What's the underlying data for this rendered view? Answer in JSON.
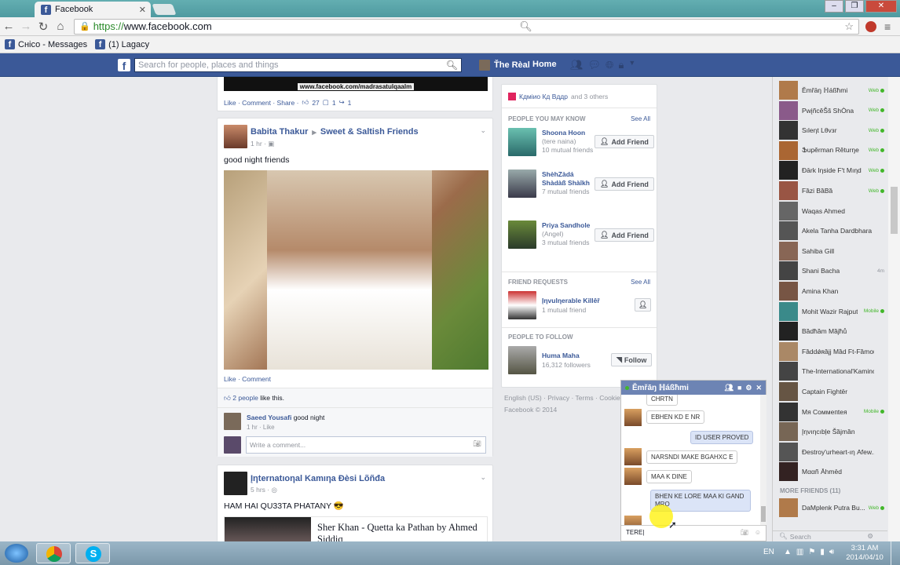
{
  "browser": {
    "tab_title": "Facebook",
    "url_prefix": "https://",
    "url_rest": "www.facebook.com",
    "bookmarks": [
      "Снісо - Messages",
      "(1) Lagacy"
    ]
  },
  "fbbar": {
    "logo": "f",
    "search_placeholder": "Search for people, places and things",
    "user": "Ťhe Rèal",
    "home": "Home"
  },
  "feed": {
    "top_post": {
      "banner_text": "www.facebook.com/madrasatulqaalm",
      "actions": "Like · Comment · Share ·",
      "likes": "27",
      "comments": "1",
      "shares": "1"
    },
    "post1": {
      "author": "Babita Thakur",
      "arrow": "▸",
      "group": "Sweet & Saltish Friends",
      "time": "1 hr ·",
      "text": "good night friends",
      "actions": "Like · Comment",
      "likes_count": "2 people",
      "likes_suffix": "like this.",
      "comment_author": "Saeed Yousafi",
      "comment_text": "good night",
      "comment_meta": "1 hr · Like",
      "comment_placeholder": "Write a comment..."
    },
    "post2": {
      "author": "Įηternatıoηal Kamıηa Ðèsi Lõñđa",
      "time": "5 hrs ·",
      "text": "HAM HAI QU33TA PHATANY 😎",
      "link_title": "Sher Khan - Quetta ka Pathan by Ahmed Siddiq"
    }
  },
  "rightcol": {
    "header_name": "Кдміио Кд Вддр",
    "header_suffix": "and 3 others",
    "pymk_title": "PEOPLE YOU MAY KNOW",
    "see_all": "See All",
    "add_friend": "Add Friend",
    "pymk": [
      {
        "name": "Shoona Hoon",
        "sub": "(tere naina)",
        "mutual": "10 mutual friends"
      },
      {
        "name": "ShèhZàdá Shàdàß Shàîkh",
        "sub": "",
        "mutual": "7 mutual friends"
      },
      {
        "name": "Priya Sandhole",
        "sub": "(Angel)",
        "mutual": "3 mutual friends"
      }
    ],
    "fr_title": "FRIEND REQUESTS",
    "fr": {
      "name": "Įηvulηerable Killêř",
      "mutual": "1 mutual friend"
    },
    "ptf_title": "PEOPLE TO FOLLOW",
    "ptf": {
      "name": "Huma Maha",
      "followers": "16,312 followers",
      "button": "Follow"
    },
    "footer1": "English (US) · Privacy · Terms · Cookie",
    "footer2": "Facebook © 2014"
  },
  "chat": {
    "title": "Ĕmřāŋ ℍáßħmi",
    "messages": [
      {
        "text": "CHRTN",
        "me": false
      },
      {
        "text": "EBHEN KD E NR",
        "me": false
      },
      {
        "text": "ID USER PROVED",
        "me": true
      },
      {
        "text": "NARSNDI MAKE BGAHXC E",
        "me": false
      },
      {
        "text": "MAA K DINE",
        "me": false
      },
      {
        "text": "BHEN KE LORE MAA KI GAND MRO",
        "me": true
      }
    ],
    "input_value": "TERE"
  },
  "sidebar": {
    "friends": [
      {
        "name": "Ĕmřāŋ ℍáßħmi",
        "status": "Web"
      },
      {
        "name": "PwįñcěŠš ShÒna",
        "status": "Web"
      },
      {
        "name": "Sıleηt Lθvзr",
        "status": "Web"
      },
      {
        "name": "Ֆupěrman Rěturŋe",
        "status": "Web"
      },
      {
        "name": "Ðārk Iηside F't Mıηd",
        "status": "Web"
      },
      {
        "name": "Fȁzi BȁBȁ",
        "status": "Web"
      },
      {
        "name": "Waqas Ahmed",
        "status": ""
      },
      {
        "name": "Akela Tanha Dardbhara ...",
        "status": ""
      },
      {
        "name": "Sahiba Gill",
        "status": ""
      },
      {
        "name": "Shani Bacha",
        "status": "4m"
      },
      {
        "name": "Amina Khan",
        "status": ""
      },
      {
        "name": "Mohit Wazir Rajput",
        "status": "Mobile"
      },
      {
        "name": "Bȁdħȁm Mȁjħů",
        "status": ""
      },
      {
        "name": "Fȁddǿʀȁjj Mȁd Ft-Fȁmous",
        "status": ""
      },
      {
        "name": "The-International'Kamino ...",
        "status": ""
      },
      {
        "name": "Captain Fightēr",
        "status": ""
      },
      {
        "name": "Mя Соммепtея",
        "status": "Mobile"
      },
      {
        "name": "Įηvıηcıbļe Šȁjmȁn",
        "status": ""
      },
      {
        "name": "Ðestroy'urheart-ıη Afew...",
        "status": ""
      },
      {
        "name": "Mααñ Āhmēd",
        "status": ""
      }
    ],
    "more_friends": "MORE FRIENDS (11)",
    "more": [
      {
        "name": "DaMplenk Putra Bu...",
        "status": "Web"
      }
    ],
    "search_placeholder": "Search"
  },
  "taskbar": {
    "lang": "EN",
    "time": "3:31 AM",
    "date": "2014/04/10"
  },
  "colors": {
    "fb_blue": "#3b5998",
    "online": "#42b72a"
  }
}
